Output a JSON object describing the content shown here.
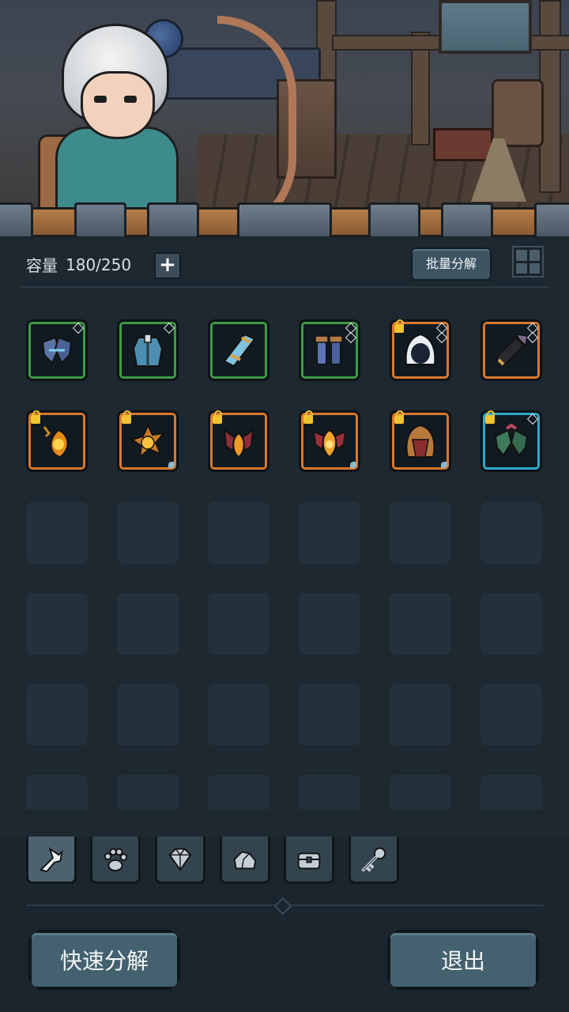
{
  "inventory": {
    "capacity_label": "容量",
    "capacity_value": "180/250",
    "expand_label": "+",
    "batch_decompose_label": "批量分解"
  },
  "items": [
    {
      "name": "shoulder-armor-blue",
      "rarity": "green",
      "rarity_color": "#3f9a45",
      "locked": false,
      "gems": 1
    },
    {
      "name": "tunic-armor",
      "rarity": "green",
      "rarity_color": "#3f9a45",
      "locked": false,
      "gems": 1
    },
    {
      "name": "bracer-crystal",
      "rarity": "green",
      "rarity_color": "#3f9a45",
      "locked": false,
      "gems": 0
    },
    {
      "name": "boots-blue",
      "rarity": "green",
      "rarity_color": "#3f9a45",
      "locked": false,
      "gems": 2
    },
    {
      "name": "hood-white",
      "rarity": "orange",
      "rarity_color": "#d9782d",
      "locked": true,
      "gems": 2
    },
    {
      "name": "bracer-feather",
      "rarity": "orange",
      "rarity_color": "#d9782d",
      "locked": false,
      "gems": 2
    },
    {
      "name": "amulet-flame",
      "rarity": "orange",
      "rarity_color": "#d9782d",
      "locked": true,
      "gems": 0
    },
    {
      "name": "amulet-sun",
      "rarity": "orange",
      "rarity_color": "#d9782d",
      "locked": true,
      "gems": 0
    },
    {
      "name": "amulet-fire-wing",
      "rarity": "orange",
      "rarity_color": "#d9782d",
      "locked": true,
      "gems": 0
    },
    {
      "name": "amulet-fire-crown",
      "rarity": "orange",
      "rarity_color": "#d9782d",
      "locked": true,
      "gems": 0
    },
    {
      "name": "helmet-bronze",
      "rarity": "orange",
      "rarity_color": "#d9782d",
      "locked": true,
      "gems": 0
    },
    {
      "name": "shoulder-armor-green",
      "rarity": "cyan",
      "rarity_color": "#2fa7c9",
      "locked": true,
      "gems": 1
    }
  ],
  "tabs": [
    {
      "name": "equipment",
      "icon": "sword-claw-icon",
      "active": true
    },
    {
      "name": "pets",
      "icon": "paw-icon",
      "active": false
    },
    {
      "name": "gems",
      "icon": "diamond-icon",
      "active": false
    },
    {
      "name": "materials",
      "icon": "ore-icon",
      "active": false
    },
    {
      "name": "chests",
      "icon": "chest-icon",
      "active": false
    },
    {
      "name": "keys",
      "icon": "key-icon",
      "active": false
    }
  ],
  "actions": {
    "quick_decompose_label": "快速分解",
    "exit_label": "退出"
  },
  "colors": {
    "panel_bg": "#1d2830",
    "slot_empty": "#24313b",
    "button_bg": "#43616f",
    "rarity_green": "#3f9a45",
    "rarity_orange": "#d9782d",
    "rarity_cyan": "#2fa7c9",
    "lock": "#f0c431"
  }
}
